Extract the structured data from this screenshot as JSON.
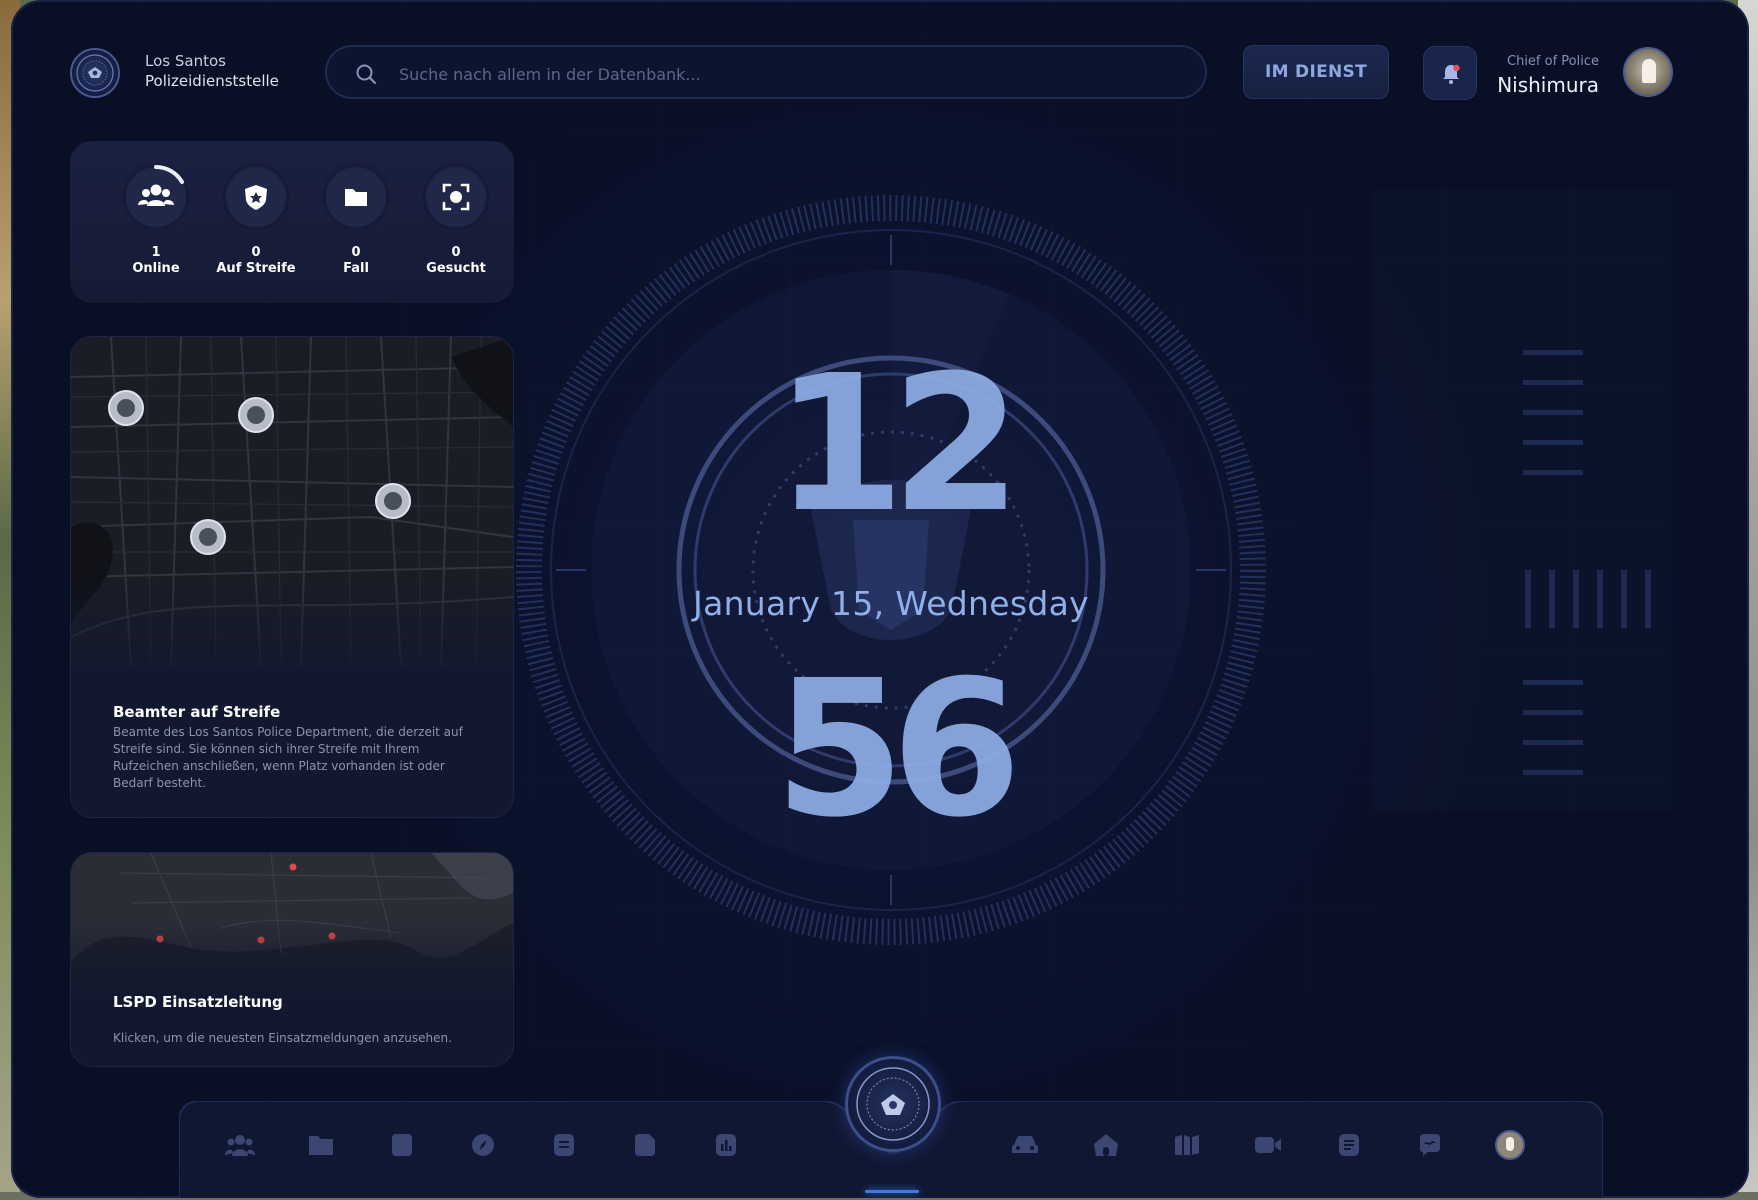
{
  "header": {
    "dept_line1": "Los Santos",
    "dept_line2": "Polizeidienststelle",
    "search_placeholder": "Suche nach allem in der Datenbank...",
    "duty_label": "IM DIENST",
    "user_rank": "Chief of Police",
    "user_name": "Nishimura"
  },
  "stats": [
    {
      "value": "1",
      "label": "Online",
      "icon": "users-icon"
    },
    {
      "value": "0",
      "label": "Auf Streife",
      "icon": "badge-icon"
    },
    {
      "value": "0",
      "label": "Fall",
      "icon": "folder-icon"
    },
    {
      "value": "0",
      "label": "Gesucht",
      "icon": "target-icon"
    }
  ],
  "patrol_card": {
    "title": "Beamter auf Streife",
    "text": "Beamte des Los Santos Police Department, die derzeit auf Streife sind. Sie können sich ihrer Streife mit Ihrem Rufzeichen anschließen, wenn Platz vorhanden ist oder Bedarf besteht."
  },
  "dispatch_card": {
    "title": "LSPD Einsatzleitung",
    "text": "Klicken, um die neuesten Einsatzmeldungen anzusehen."
  },
  "clock": {
    "hours": "12",
    "minutes": "56",
    "date": "January 15, Wednesday"
  },
  "dock": {
    "left_icons": [
      "users-icon",
      "folder-icon",
      "database-icon",
      "compass-icon",
      "document-icon",
      "note-icon",
      "chart-icon"
    ],
    "right_icons": [
      "car-icon",
      "house-icon",
      "map-icon",
      "camera-icon",
      "report-icon",
      "chat-icon",
      "profile-icon"
    ]
  },
  "colors": {
    "background": "#0a1027",
    "panel": "#181e3a",
    "accent": "#8eaee6",
    "active": "#3f7ae8",
    "dispatch_marker": "#e04a4a"
  }
}
